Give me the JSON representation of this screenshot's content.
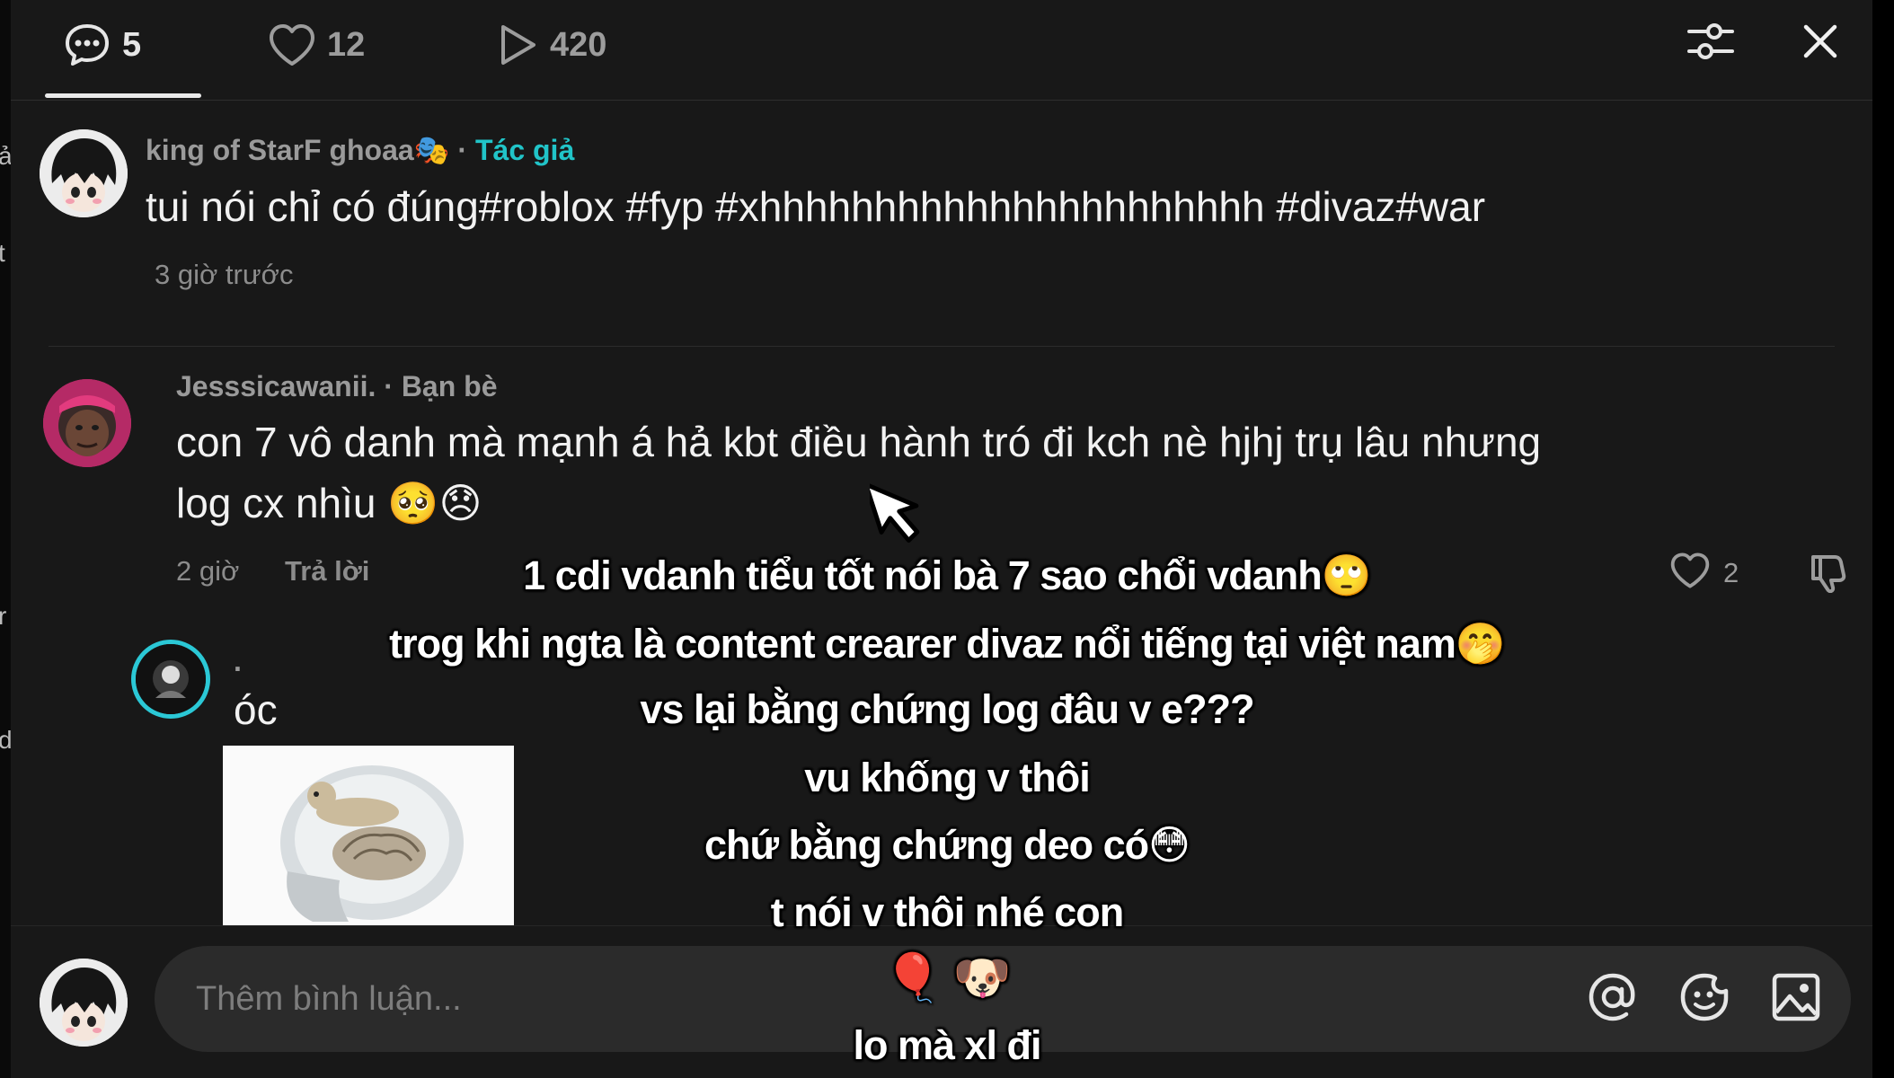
{
  "header": {
    "comments_count": "5",
    "likes_count": "12",
    "views_count": "420",
    "icons": [
      "comment-bubble-icon",
      "heart-icon",
      "play-icon",
      "filter-sliders-icon",
      "close-icon"
    ]
  },
  "comments": [
    {
      "username": "king of StarF ghoaa🎭",
      "tag": "Tác giả",
      "text": "tui nói chỉ có đúng#roblox #fyp #xhhhhhhhhhhhhhhhhhhhhhh #divaz#war",
      "time": "3 giờ trước"
    },
    {
      "username": "Jesssicawanii.",
      "tag": "Bạn bè",
      "text_line1": "con 7 vô danh mà mạnh á hả kbt điều hành tró đi kch nè hjhj trụ lâu nhưng",
      "text_line2": "log cx nhìu 🥺😞",
      "time": "2 giờ",
      "reply_label": "Trả lời",
      "like_count": "2"
    },
    {
      "username": ".",
      "text": "óc"
    }
  ],
  "input": {
    "placeholder": "Thêm bình luận..."
  },
  "overlay_caption": {
    "line1": "1 cdi vdanh tiểu tốt nói bà 7 sao chổi vdanh🙄",
    "line2": "trog khi ngta là content crearer divaz nổi tiếng tại việt nam🤭",
    "line3": "vs lại bằng chứng log đâu v e???",
    "line4": "vu khống v thôi",
    "line5": "chứ bằng chứng deo có😳",
    "line6": "t nói v thôi nhé con",
    "line7": "🎈 🐶",
    "line8": "lo mà xl đi"
  },
  "left_strip": {
    "glyphs": [
      "ả",
      "t",
      "r",
      "d"
    ]
  },
  "colors": {
    "panel_bg": "#181818",
    "author_tag": "#21c4c8",
    "input_bg": "#2b2b2b"
  }
}
